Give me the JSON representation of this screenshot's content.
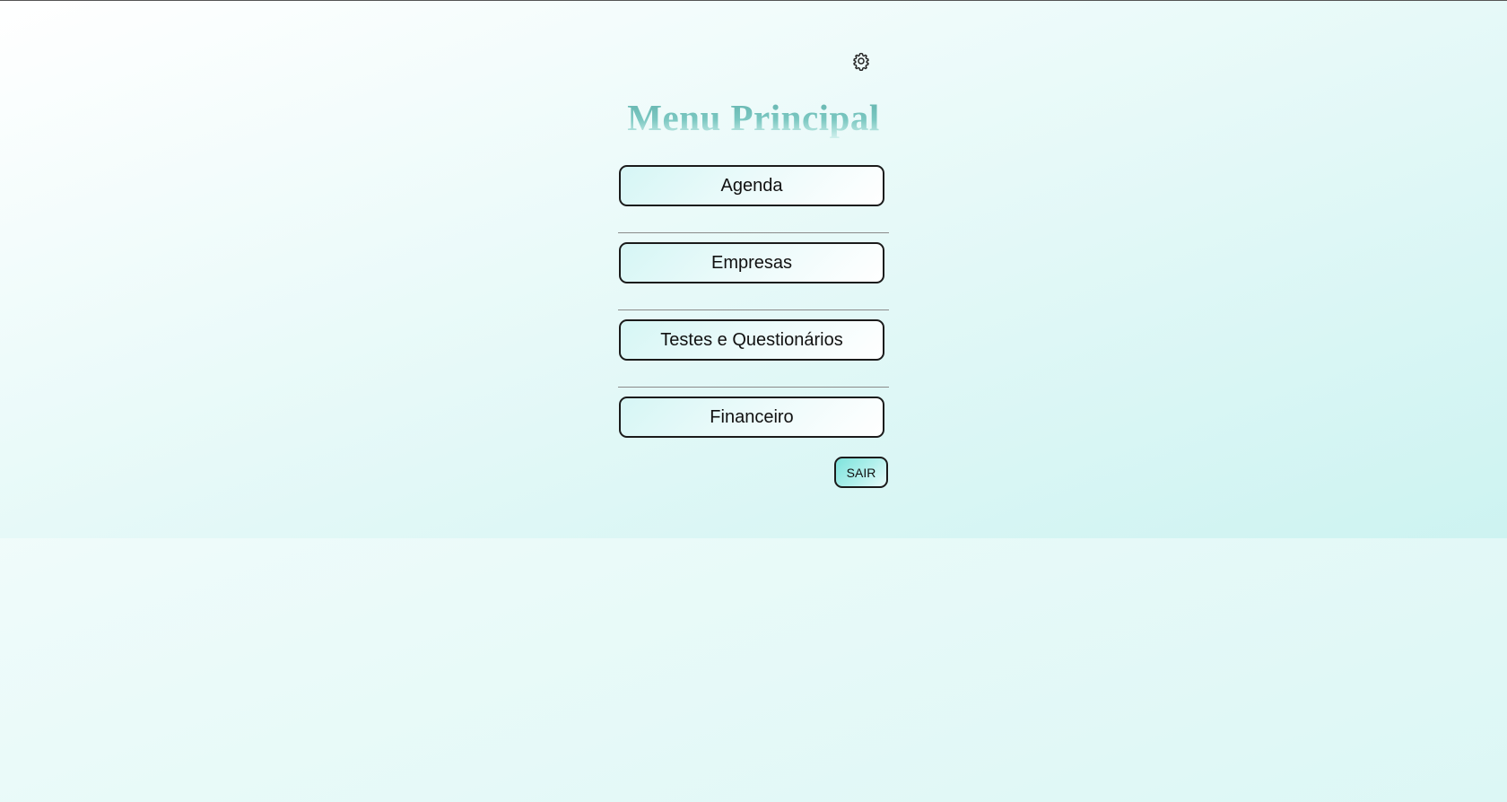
{
  "header": {
    "settings_icon": "gear-icon",
    "title": "Menu Principal"
  },
  "menu": {
    "items": [
      {
        "label": "Agenda"
      },
      {
        "label": "Empresas"
      },
      {
        "label": "Testes e Questionários"
      },
      {
        "label": "Financeiro"
      }
    ]
  },
  "actions": {
    "exit_label": "SAIR"
  },
  "colors": {
    "background_start": "#ffffff",
    "background_end": "#cdf3f1",
    "title_color": "#6fbfb8",
    "button_border": "#1b1b1b",
    "exit_button_accent": "#7ee3dc",
    "divider": "#8a8a8a"
  }
}
